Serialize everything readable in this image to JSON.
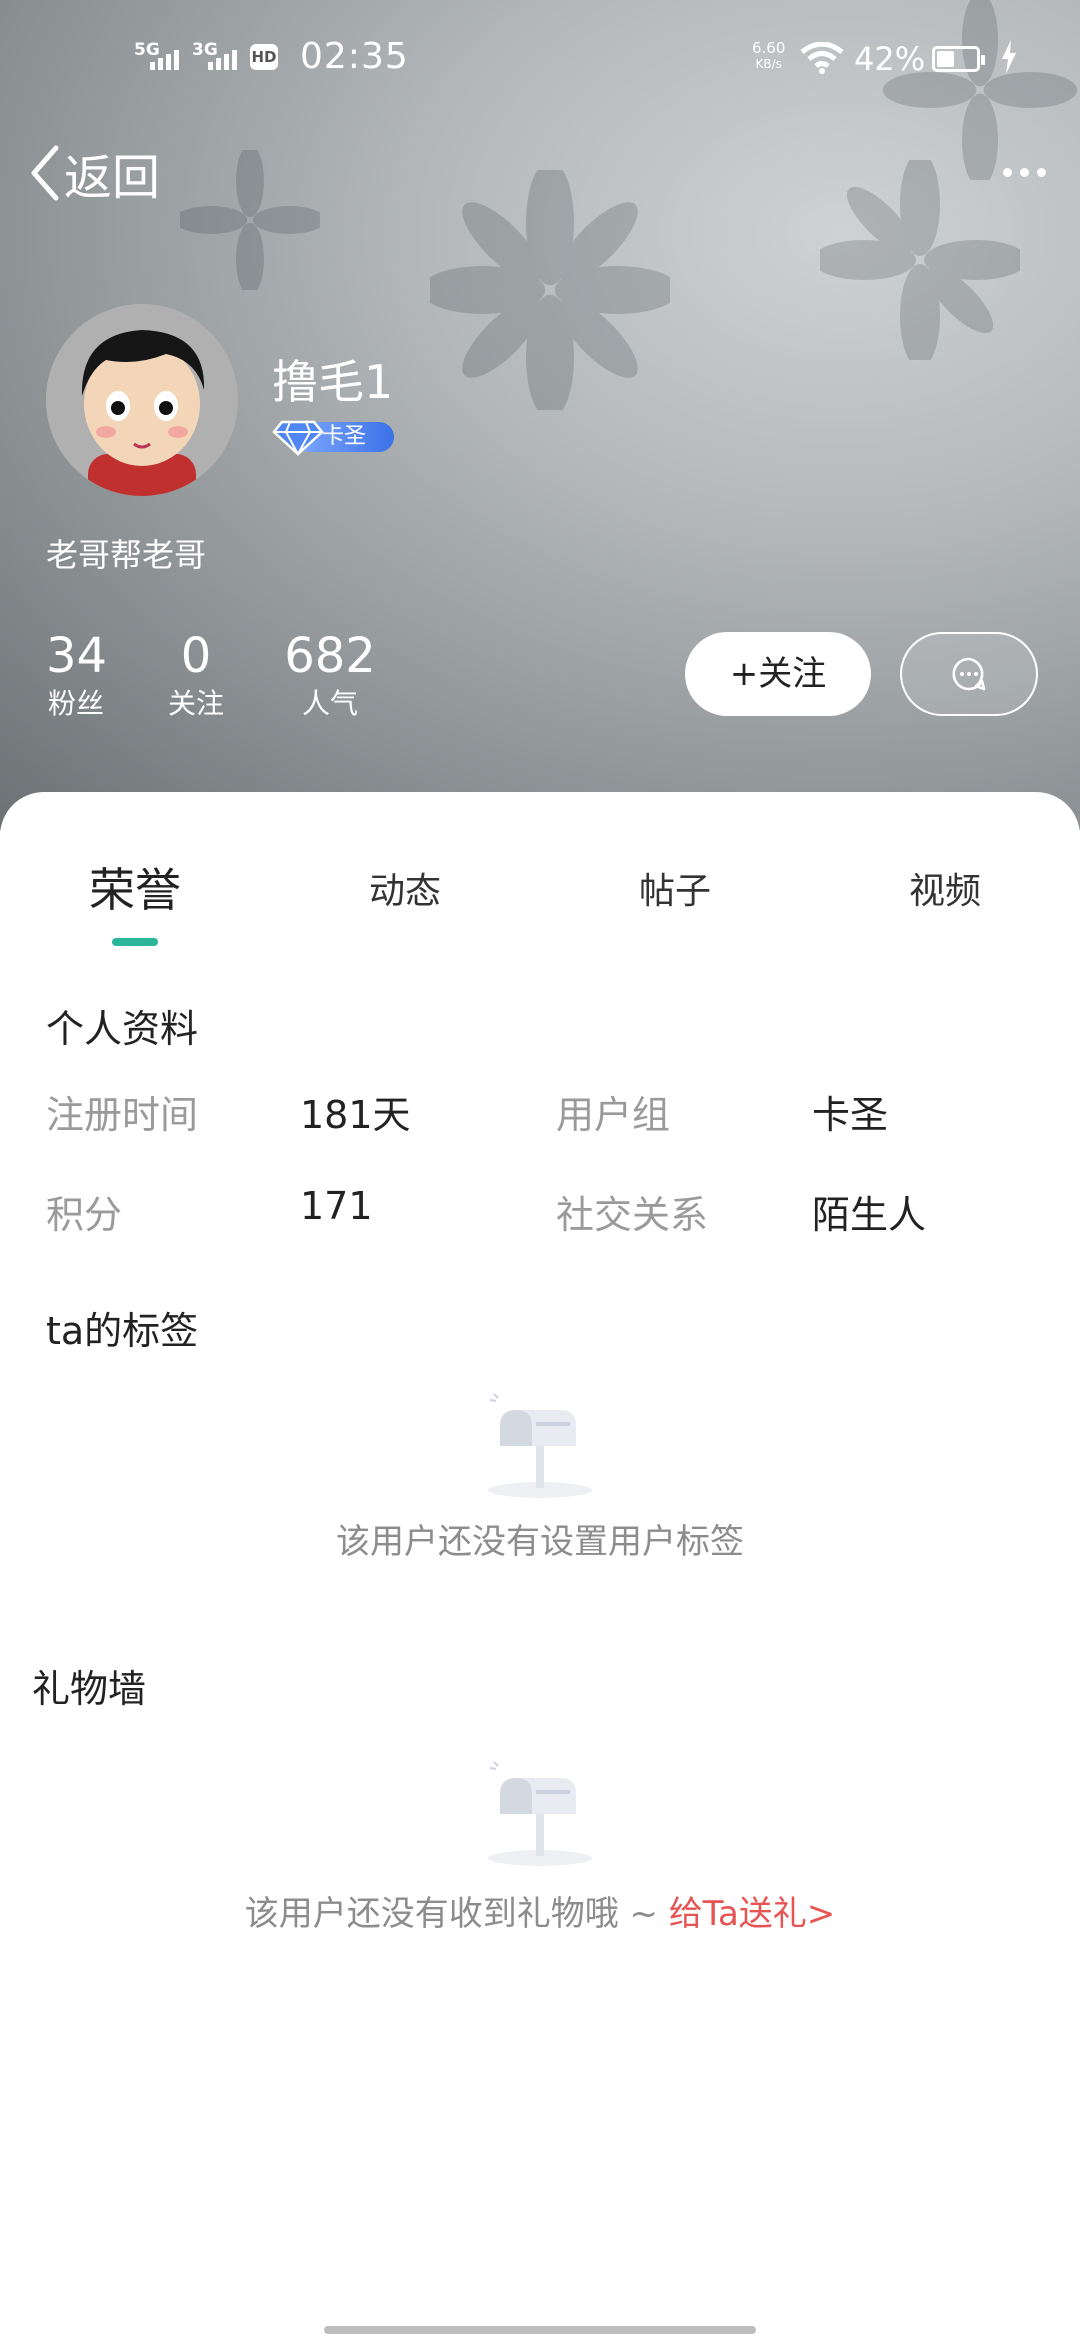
{
  "status_bar": {
    "network1": "5G",
    "network2": "3G",
    "hd": "HD",
    "time": "02:35",
    "speed_value": "6.60",
    "speed_unit": "KB/s",
    "battery": "42%"
  },
  "nav": {
    "back_label": "返回"
  },
  "profile": {
    "username": "撸毛1",
    "badge": "卡圣",
    "bio": "老哥帮老哥",
    "stats": [
      {
        "value": "34",
        "label": "粉丝"
      },
      {
        "value": "0",
        "label": "关注"
      },
      {
        "value": "682",
        "label": "人气"
      }
    ],
    "follow_label": "+关注"
  },
  "tabs": [
    {
      "label": "荣誉",
      "active": true
    },
    {
      "label": "动态",
      "active": false
    },
    {
      "label": "帖子",
      "active": false
    },
    {
      "label": "视频",
      "active": false
    }
  ],
  "personal_info": {
    "title": "个人资料",
    "rows": [
      {
        "label1": "注册时间",
        "value1": "181天",
        "label2": "用户组",
        "value2": "卡圣"
      },
      {
        "label1": "积分",
        "value1": "171",
        "label2": "社交关系",
        "value2": "陌生人"
      }
    ]
  },
  "tags": {
    "title": "ta的标签",
    "empty_text": "该用户还没有设置用户标签"
  },
  "gift_wall": {
    "title": "礼物墙",
    "empty_text": "该用户还没有收到礼物哦 ~ ",
    "gift_link": "给Ta送礼>"
  },
  "colors": {
    "accent": "#2bb59a",
    "link": "#e65454"
  }
}
